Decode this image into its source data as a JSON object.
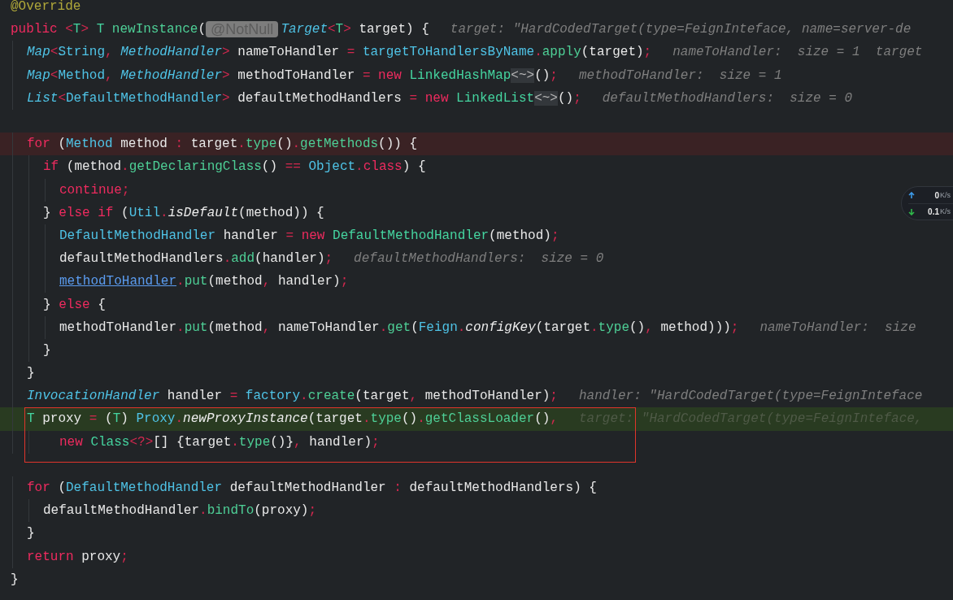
{
  "editor": {
    "lines": [
      {
        "kind": "code",
        "segments": [
          {
            "kind": "code",
            "tokens": [
              {
                "kind": "ann",
                "text": "@Override"
              }
            ]
          }
        ]
      },
      {
        "kind": "code",
        "segments": [
          {
            "kind": "code",
            "tokens": [
              {
                "kind": "kw",
                "text": "public "
              },
              {
                "kind": "op",
                "text": "<"
              },
              {
                "kind": "cls",
                "text": "T"
              },
              {
                "kind": "op",
                "text": "> "
              },
              {
                "kind": "cls",
                "text": "T "
              },
              {
                "kind": "fn",
                "text": "newInstance"
              },
              {
                "kind": "id",
                "text": "("
              }
            ]
          },
          {
            "kind": "chip",
            "text": "@NotNull"
          },
          {
            "kind": "code",
            "tokens": [
              {
                "kind": "itype",
                "text": "Target"
              },
              {
                "kind": "op",
                "text": "<"
              },
              {
                "kind": "cls",
                "text": "T"
              },
              {
                "kind": "op",
                "text": ">"
              },
              {
                "kind": "id",
                "text": " target) {"
              }
            ]
          },
          {
            "kind": "hint",
            "text": "target: \"HardCodedTarget(type=FeignInteface, name=server-de"
          }
        ],
        "children": [
          {
            "kind": "code",
            "segments": [
              {
                "kind": "code",
                "tokens": [
                  {
                    "kind": "itype",
                    "text": "Map"
                  },
                  {
                    "kind": "op",
                    "text": "<"
                  },
                  {
                    "kind": "type",
                    "text": "String"
                  },
                  {
                    "kind": "op",
                    "text": ", "
                  },
                  {
                    "kind": "itype",
                    "text": "MethodHandler"
                  },
                  {
                    "kind": "op",
                    "text": ">"
                  },
                  {
                    "kind": "id",
                    "text": " nameToHandler "
                  },
                  {
                    "kind": "op",
                    "text": "= "
                  },
                  {
                    "kind": "type",
                    "text": "targetToHandlersByName"
                  },
                  {
                    "kind": "op",
                    "text": "."
                  },
                  {
                    "kind": "fn",
                    "text": "apply"
                  },
                  {
                    "kind": "id",
                    "text": "(target)"
                  },
                  {
                    "kind": "op",
                    "text": ";"
                  }
                ]
              },
              {
                "kind": "hint",
                "text": "nameToHandler:  size = 1  target"
              }
            ]
          },
          {
            "kind": "code",
            "segments": [
              {
                "kind": "code",
                "tokens": [
                  {
                    "kind": "itype",
                    "text": "Map"
                  },
                  {
                    "kind": "op",
                    "text": "<"
                  },
                  {
                    "kind": "type",
                    "text": "Method"
                  },
                  {
                    "kind": "op",
                    "text": ", "
                  },
                  {
                    "kind": "itype",
                    "text": "MethodHandler"
                  },
                  {
                    "kind": "op",
                    "text": ">"
                  },
                  {
                    "kind": "id",
                    "text": " methodToHandler "
                  },
                  {
                    "kind": "op",
                    "text": "= "
                  },
                  {
                    "kind": "kw",
                    "text": "new "
                  },
                  {
                    "kind": "cls",
                    "text": "LinkedHashMap"
                  },
                  {
                    "kind": "dia",
                    "text": "<~>"
                  },
                  {
                    "kind": "id",
                    "text": "()"
                  },
                  {
                    "kind": "op",
                    "text": ";"
                  }
                ]
              },
              {
                "kind": "hint",
                "text": "methodToHandler:  size = 1"
              }
            ]
          },
          {
            "kind": "code",
            "segments": [
              {
                "kind": "code",
                "tokens": [
                  {
                    "kind": "itype",
                    "text": "List"
                  },
                  {
                    "kind": "op",
                    "text": "<"
                  },
                  {
                    "kind": "type",
                    "text": "DefaultMethodHandler"
                  },
                  {
                    "kind": "op",
                    "text": ">"
                  },
                  {
                    "kind": "id",
                    "text": " defaultMethodHandlers "
                  },
                  {
                    "kind": "op",
                    "text": "= "
                  },
                  {
                    "kind": "kw",
                    "text": "new "
                  },
                  {
                    "kind": "cls",
                    "text": "LinkedList"
                  },
                  {
                    "kind": "dia",
                    "text": "<~>"
                  },
                  {
                    "kind": "id",
                    "text": "()"
                  },
                  {
                    "kind": "op",
                    "text": ";"
                  }
                ]
              },
              {
                "kind": "hint",
                "text": "defaultMethodHandlers:  size = 0"
              }
            ]
          },
          {
            "kind": "blank"
          },
          {
            "kind": "code",
            "breakpoint": true,
            "segments": [
              {
                "kind": "code",
                "tokens": [
                  {
                    "kind": "kw",
                    "text": "for"
                  },
                  {
                    "kind": "id",
                    "text": " ("
                  },
                  {
                    "kind": "type",
                    "text": "Method"
                  },
                  {
                    "kind": "id",
                    "text": " method "
                  },
                  {
                    "kind": "op",
                    "text": ":"
                  },
                  {
                    "kind": "id",
                    "text": " target"
                  },
                  {
                    "kind": "op",
                    "text": "."
                  },
                  {
                    "kind": "fn",
                    "text": "type"
                  },
                  {
                    "kind": "id",
                    "text": "()"
                  },
                  {
                    "kind": "op",
                    "text": "."
                  },
                  {
                    "kind": "fn",
                    "text": "getMethods"
                  },
                  {
                    "kind": "id",
                    "text": "()) {"
                  }
                ]
              }
            ],
            "children": [
              {
                "kind": "code",
                "segments": [
                  {
                    "kind": "code",
                    "tokens": [
                      {
                        "kind": "kw",
                        "text": "if"
                      },
                      {
                        "kind": "id",
                        "text": " (method"
                      },
                      {
                        "kind": "op",
                        "text": "."
                      },
                      {
                        "kind": "fn",
                        "text": "getDeclaringClass"
                      },
                      {
                        "kind": "id",
                        "text": "() "
                      },
                      {
                        "kind": "op",
                        "text": "== "
                      },
                      {
                        "kind": "type",
                        "text": "Object"
                      },
                      {
                        "kind": "op",
                        "text": "."
                      },
                      {
                        "kind": "kw",
                        "text": "class"
                      },
                      {
                        "kind": "id",
                        "text": ") {"
                      }
                    ]
                  }
                ],
                "children": [
                  {
                    "kind": "code",
                    "segments": [
                      {
                        "kind": "code",
                        "tokens": [
                          {
                            "kind": "kw",
                            "text": "continue"
                          },
                          {
                            "kind": "op",
                            "text": ";"
                          }
                        ]
                      }
                    ]
                  }
                ]
              },
              {
                "kind": "code",
                "segments": [
                  {
                    "kind": "code",
                    "tokens": [
                      {
                        "kind": "id",
                        "text": "} "
                      },
                      {
                        "kind": "kw",
                        "text": "else if"
                      },
                      {
                        "kind": "id",
                        "text": " ("
                      },
                      {
                        "kind": "type",
                        "text": "Util"
                      },
                      {
                        "kind": "op",
                        "text": "."
                      },
                      {
                        "kind": "ifn",
                        "text": "isDefault"
                      },
                      {
                        "kind": "id",
                        "text": "(method)) {"
                      }
                    ]
                  }
                ],
                "children": [
                  {
                    "kind": "code",
                    "segments": [
                      {
                        "kind": "code",
                        "tokens": [
                          {
                            "kind": "type",
                            "text": "DefaultMethodHandler"
                          },
                          {
                            "kind": "id",
                            "text": " handler "
                          },
                          {
                            "kind": "op",
                            "text": "= "
                          },
                          {
                            "kind": "kw",
                            "text": "new "
                          },
                          {
                            "kind": "cls",
                            "text": "DefaultMethodHandler"
                          },
                          {
                            "kind": "id",
                            "text": "(method)"
                          },
                          {
                            "kind": "op",
                            "text": ";"
                          }
                        ]
                      }
                    ]
                  },
                  {
                    "kind": "code",
                    "segments": [
                      {
                        "kind": "code",
                        "tokens": [
                          {
                            "kind": "id",
                            "text": "defaultMethodHandlers"
                          },
                          {
                            "kind": "op",
                            "text": "."
                          },
                          {
                            "kind": "fn",
                            "text": "add"
                          },
                          {
                            "kind": "id",
                            "text": "(handler)"
                          },
                          {
                            "kind": "op",
                            "text": ";"
                          }
                        ]
                      },
                      {
                        "kind": "hint",
                        "text": "defaultMethodHandlers:  size = 0"
                      }
                    ]
                  },
                  {
                    "kind": "code",
                    "segments": [
                      {
                        "kind": "code",
                        "tokens": [
                          {
                            "kind": "link",
                            "text": "methodToHandler"
                          },
                          {
                            "kind": "op",
                            "text": "."
                          },
                          {
                            "kind": "fn",
                            "text": "put"
                          },
                          {
                            "kind": "id",
                            "text": "(method"
                          },
                          {
                            "kind": "op",
                            "text": ", "
                          },
                          {
                            "kind": "id",
                            "text": "handler)"
                          },
                          {
                            "kind": "op",
                            "text": ";"
                          }
                        ]
                      }
                    ]
                  }
                ]
              },
              {
                "kind": "code",
                "segments": [
                  {
                    "kind": "code",
                    "tokens": [
                      {
                        "kind": "id",
                        "text": "} "
                      },
                      {
                        "kind": "kw",
                        "text": "else"
                      },
                      {
                        "kind": "id",
                        "text": " {"
                      }
                    ]
                  }
                ],
                "children": [
                  {
                    "kind": "code",
                    "segments": [
                      {
                        "kind": "code",
                        "tokens": [
                          {
                            "kind": "id",
                            "text": "methodToHandler"
                          },
                          {
                            "kind": "op",
                            "text": "."
                          },
                          {
                            "kind": "fn",
                            "text": "put"
                          },
                          {
                            "kind": "id",
                            "text": "(method"
                          },
                          {
                            "kind": "op",
                            "text": ", "
                          },
                          {
                            "kind": "id",
                            "text": "nameToHandler"
                          },
                          {
                            "kind": "op",
                            "text": "."
                          },
                          {
                            "kind": "fn",
                            "text": "get"
                          },
                          {
                            "kind": "id",
                            "text": "("
                          },
                          {
                            "kind": "type",
                            "text": "Feign"
                          },
                          {
                            "kind": "op",
                            "text": "."
                          },
                          {
                            "kind": "ifn",
                            "text": "configKey"
                          },
                          {
                            "kind": "id",
                            "text": "(target"
                          },
                          {
                            "kind": "op",
                            "text": "."
                          },
                          {
                            "kind": "fn",
                            "text": "type"
                          },
                          {
                            "kind": "id",
                            "text": "()"
                          },
                          {
                            "kind": "op",
                            "text": ", "
                          },
                          {
                            "kind": "id",
                            "text": "method)))"
                          },
                          {
                            "kind": "op",
                            "text": ";"
                          }
                        ]
                      },
                      {
                        "kind": "hint",
                        "text": "nameToHandler:  size"
                      }
                    ]
                  }
                ]
              },
              {
                "kind": "code",
                "segments": [
                  {
                    "kind": "code",
                    "tokens": [
                      {
                        "kind": "id",
                        "text": "}"
                      }
                    ]
                  }
                ]
              }
            ]
          },
          {
            "kind": "code",
            "segments": [
              {
                "kind": "code",
                "tokens": [
                  {
                    "kind": "id",
                    "text": "}"
                  }
                ]
              }
            ]
          },
          {
            "kind": "code",
            "segments": [
              {
                "kind": "code",
                "tokens": [
                  {
                    "kind": "itype",
                    "text": "InvocationHandler"
                  },
                  {
                    "kind": "id",
                    "text": " handler "
                  },
                  {
                    "kind": "op",
                    "text": "= "
                  },
                  {
                    "kind": "type",
                    "text": "factory"
                  },
                  {
                    "kind": "op",
                    "text": "."
                  },
                  {
                    "kind": "fn",
                    "text": "create"
                  },
                  {
                    "kind": "id",
                    "text": "(target"
                  },
                  {
                    "kind": "op",
                    "text": ", "
                  },
                  {
                    "kind": "id",
                    "text": "methodToHandler)"
                  },
                  {
                    "kind": "op",
                    "text": ";"
                  }
                ]
              },
              {
                "kind": "hint",
                "text": "handler: \"HardCodedTarget(type=FeignInteface"
              }
            ]
          },
          {
            "kind": "code",
            "current": true,
            "boxed": true,
            "segments": [
              {
                "kind": "code",
                "tokens": [
                  {
                    "kind": "cls",
                    "text": "T"
                  },
                  {
                    "kind": "id",
                    "text": " proxy "
                  },
                  {
                    "kind": "op",
                    "text": "= "
                  },
                  {
                    "kind": "id",
                    "text": "("
                  },
                  {
                    "kind": "cls",
                    "text": "T"
                  },
                  {
                    "kind": "id",
                    "text": ") "
                  },
                  {
                    "kind": "type",
                    "text": "Proxy"
                  },
                  {
                    "kind": "op",
                    "text": "."
                  },
                  {
                    "kind": "ifn",
                    "text": "newProxyInstance"
                  },
                  {
                    "kind": "id",
                    "text": "(target"
                  },
                  {
                    "kind": "op",
                    "text": "."
                  },
                  {
                    "kind": "fn",
                    "text": "type"
                  },
                  {
                    "kind": "id",
                    "text": "()"
                  },
                  {
                    "kind": "op",
                    "text": "."
                  },
                  {
                    "kind": "fn",
                    "text": "getClassLoader"
                  },
                  {
                    "kind": "id",
                    "text": "()"
                  },
                  {
                    "kind": "op",
                    "text": ","
                  }
                ]
              },
              {
                "kind": "hint",
                "text": "target: \"HardCodedTarget(type=FeignInteface,"
              }
            ],
            "children": [
              {
                "kind": "continuation",
                "boxed": true,
                "segments": [
                  {
                    "kind": "code",
                    "tokens": [
                      {
                        "kind": "kw",
                        "text": "new "
                      },
                      {
                        "kind": "cls",
                        "text": "Class"
                      },
                      {
                        "kind": "op",
                        "text": "<?>"
                      },
                      {
                        "kind": "id",
                        "text": "[] {target"
                      },
                      {
                        "kind": "op",
                        "text": "."
                      },
                      {
                        "kind": "fn",
                        "text": "type"
                      },
                      {
                        "kind": "id",
                        "text": "()}"
                      },
                      {
                        "kind": "op",
                        "text": ", "
                      },
                      {
                        "kind": "id",
                        "text": "handler)"
                      },
                      {
                        "kind": "op",
                        "text": ";"
                      }
                    ]
                  }
                ]
              }
            ]
          },
          {
            "kind": "blank"
          },
          {
            "kind": "code",
            "segments": [
              {
                "kind": "code",
                "tokens": [
                  {
                    "kind": "kw",
                    "text": "for"
                  },
                  {
                    "kind": "id",
                    "text": " ("
                  },
                  {
                    "kind": "type",
                    "text": "DefaultMethodHandler"
                  },
                  {
                    "kind": "id",
                    "text": " defaultMethodHandler "
                  },
                  {
                    "kind": "op",
                    "text": ":"
                  },
                  {
                    "kind": "id",
                    "text": " defaultMethodHandlers) {"
                  }
                ]
              }
            ],
            "children": [
              {
                "kind": "code",
                "segments": [
                  {
                    "kind": "code",
                    "tokens": [
                      {
                        "kind": "id",
                        "text": "defaultMethodHandler"
                      },
                      {
                        "kind": "op",
                        "text": "."
                      },
                      {
                        "kind": "fn",
                        "text": "bindTo"
                      },
                      {
                        "kind": "id",
                        "text": "(proxy)"
                      },
                      {
                        "kind": "op",
                        "text": ";"
                      }
                    ]
                  }
                ]
              }
            ]
          },
          {
            "kind": "code",
            "segments": [
              {
                "kind": "code",
                "tokens": [
                  {
                    "kind": "id",
                    "text": "}"
                  }
                ]
              }
            ]
          },
          {
            "kind": "code",
            "segments": [
              {
                "kind": "code",
                "tokens": [
                  {
                    "kind": "kw",
                    "text": "return"
                  },
                  {
                    "kind": "id",
                    "text": " proxy"
                  },
                  {
                    "kind": "op",
                    "text": ";"
                  }
                ]
              }
            ]
          }
        ]
      },
      {
        "kind": "code",
        "segments": [
          {
            "kind": "code",
            "tokens": [
              {
                "kind": "id",
                "text": "}"
              }
            ]
          }
        ]
      }
    ]
  },
  "network_widget": {
    "upload": {
      "value": "0",
      "unit": "K/s"
    },
    "download": {
      "value": "0.1",
      "unit": "K/s"
    }
  }
}
